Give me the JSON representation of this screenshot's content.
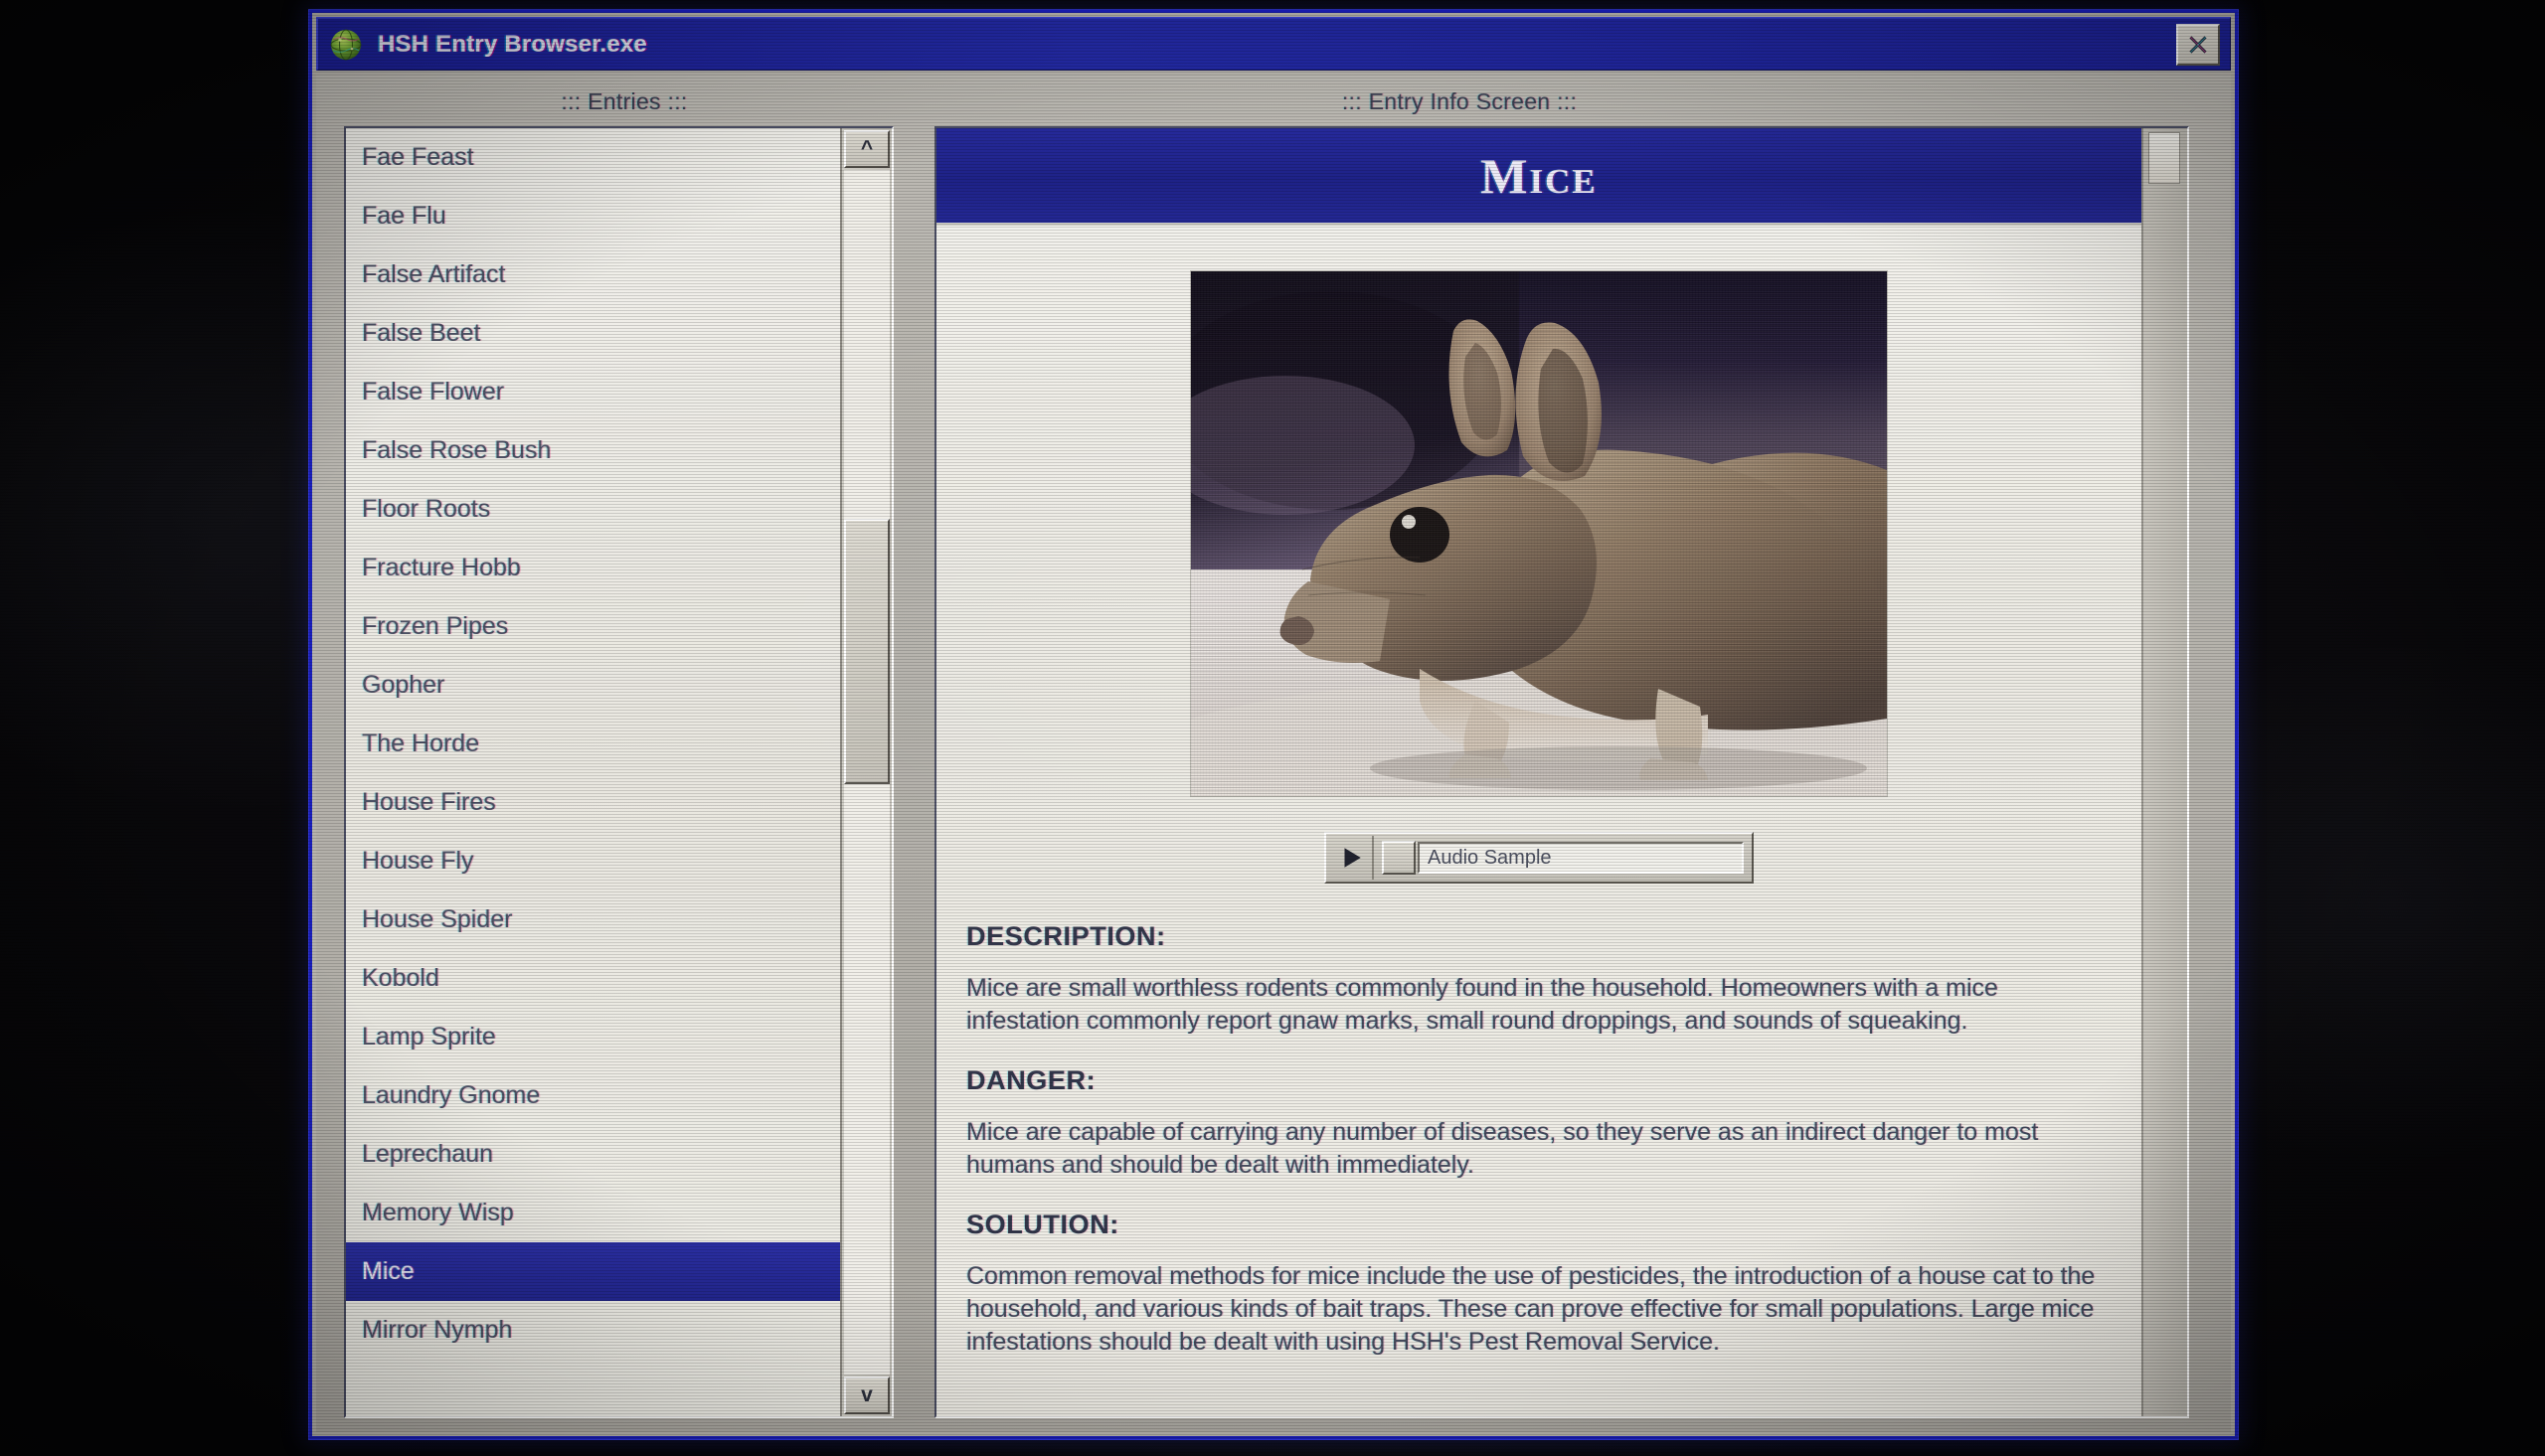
{
  "window": {
    "title": "HSH Entry Browser.exe",
    "icon": "globe-icon",
    "close_label": "X",
    "title_bar_color": "#1e2299",
    "chrome_color": "#b5b2ab"
  },
  "panels": {
    "entries_heading": "::: Entries :::",
    "info_heading": "::: Entry Info Screen :::"
  },
  "entries": {
    "selected": "Mice",
    "items": [
      "Fae Feast",
      "Fae Flu",
      "False Artifact",
      "False Beet",
      "False Flower",
      "False Rose Bush",
      "Floor Roots",
      "Fracture Hobb",
      "Frozen Pipes",
      "Gopher",
      "The Horde",
      "House Fires",
      "House Fly",
      "House Spider",
      "Kobold",
      "Lamp Sprite",
      "Laundry Gnome",
      "Leprechaun",
      "Memory Wisp",
      "Mice",
      "Mirror Nymph"
    ],
    "scrollbar": {
      "up_arrow": "^",
      "down_arrow": "v"
    }
  },
  "entry": {
    "title": "Mice",
    "photo_alt": "mouse-photograph",
    "audio": {
      "play_icon": "play-triangle-icon",
      "label": "Audio Sample"
    },
    "sections": [
      {
        "label": "DESCRIPTION:",
        "body": "Mice are small worthless rodents commonly found in the household. Homeowners with a mice infestation commonly report gnaw marks, small round droppings, and sounds of squeaking."
      },
      {
        "label": "DANGER:",
        "body": "Mice are capable of carrying any number of diseases, so they serve as an indirect danger to most humans and should be dealt with immediately."
      },
      {
        "label": "SOLUTION:",
        "body": "Common removal methods for mice include the use of pesticides, the introduction of a house cat to the household, and various kinds of bait traps. These can prove effective for small populations. Large mice infestations should be dealt with using HSH's Pest Removal Service."
      }
    ]
  }
}
